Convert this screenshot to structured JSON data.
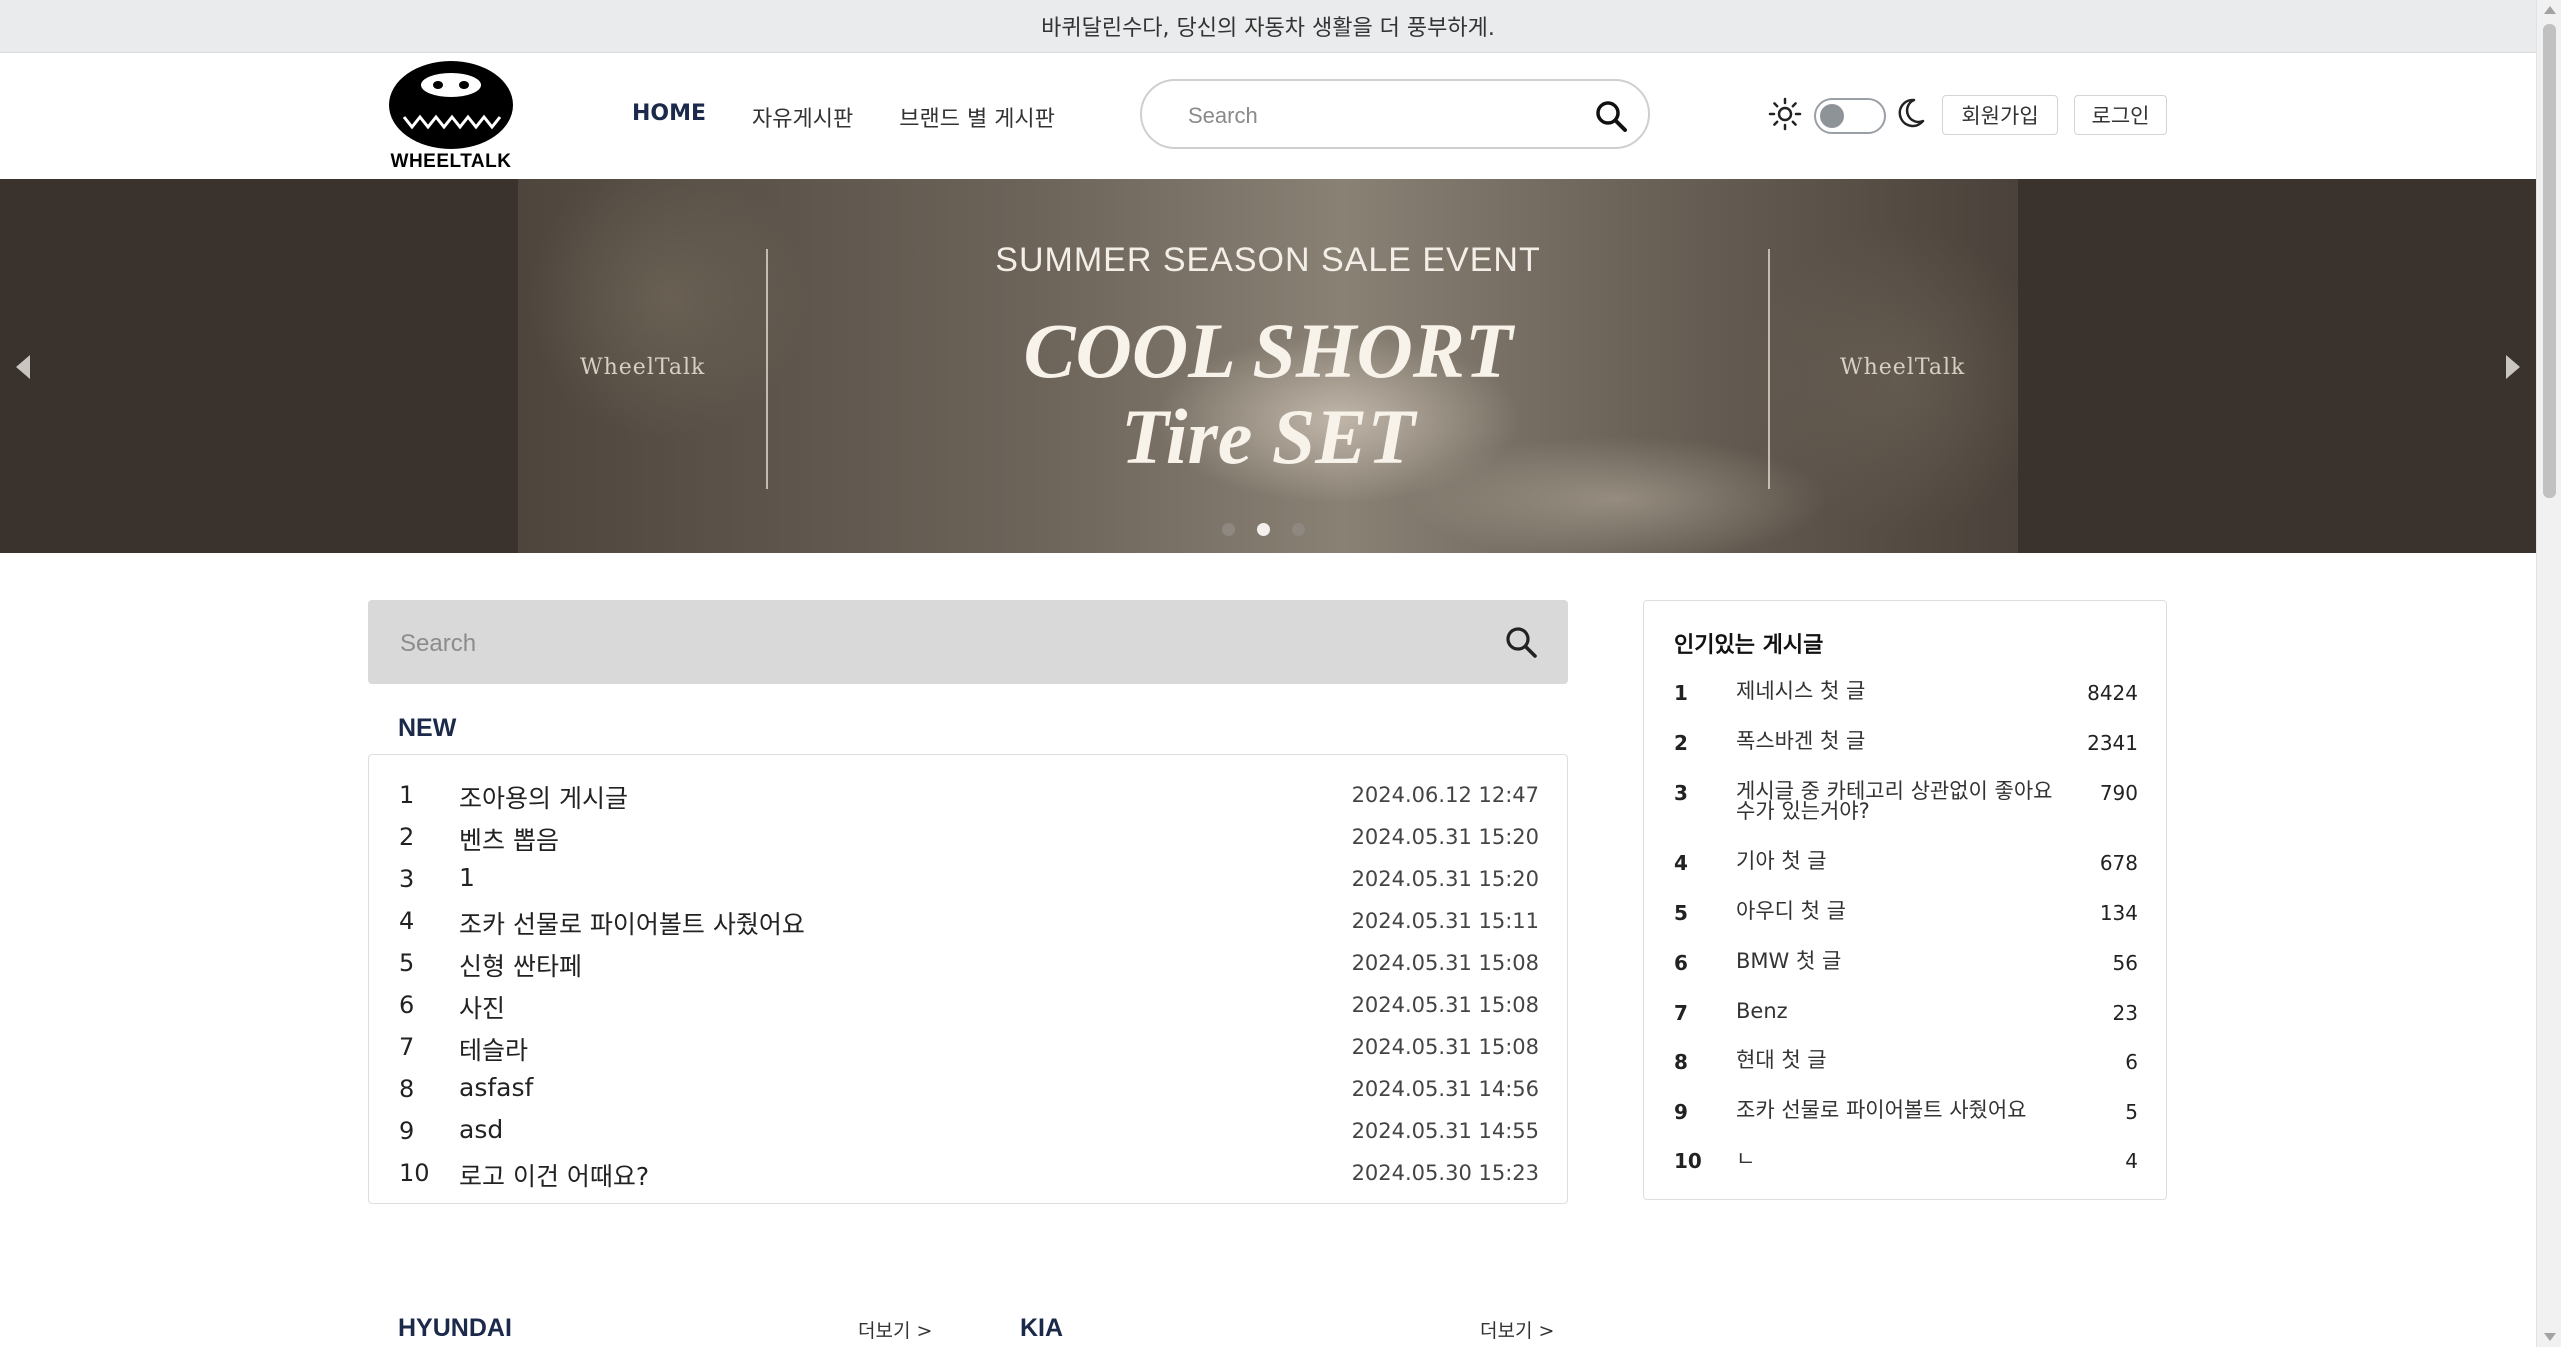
{
  "announcement": "바퀴달린수다, 당신의 자동차 생활을 더 풍부하게.",
  "logo": {
    "text": "WHEELTALK",
    "icon": "wheel-face-icon"
  },
  "nav": [
    {
      "label": "HOME",
      "active": true
    },
    {
      "label": "자유게시판",
      "active": false
    },
    {
      "label": "브랜드 별 게시판",
      "active": false
    }
  ],
  "header_search": {
    "placeholder": "Search",
    "icon": "search-icon"
  },
  "theme": {
    "sun_icon": "sun-icon",
    "moon_icon": "moon-icon",
    "dark_mode": false
  },
  "auth": {
    "signup": "회원가입",
    "login": "로그인"
  },
  "banner": {
    "subtitle": "SUMMER SEASON SALE EVENT",
    "title_line1": "COOL SHORT",
    "title_line2": "Tire SET",
    "watermark": "WheelTalk",
    "slide_count": 3,
    "active_slide": 2
  },
  "main_search": {
    "placeholder": "Search",
    "icon": "search-icon"
  },
  "new_section": {
    "title": "NEW",
    "items": [
      {
        "num": "1",
        "title": "조아용의 게시글",
        "date": "2024.06.12 12:47"
      },
      {
        "num": "2",
        "title": "벤츠 뽑음",
        "date": "2024.05.31 15:20"
      },
      {
        "num": "3",
        "title": "1",
        "date": "2024.05.31 15:20"
      },
      {
        "num": "4",
        "title": "조카 선물로 파이어볼트 사줬어요",
        "date": "2024.05.31 15:11"
      },
      {
        "num": "5",
        "title": "신형 싼타페",
        "date": "2024.05.31 15:08"
      },
      {
        "num": "6",
        "title": "사진",
        "date": "2024.05.31 15:08"
      },
      {
        "num": "7",
        "title": "테슬라",
        "date": "2024.05.31 15:08"
      },
      {
        "num": "8",
        "title": "asfasf",
        "date": "2024.05.31 14:56"
      },
      {
        "num": "9",
        "title": "asd",
        "date": "2024.05.31 14:55"
      },
      {
        "num": "10",
        "title": "로고 이건 어때요?",
        "date": "2024.05.30 15:23"
      }
    ]
  },
  "popular": {
    "title": "인기있는 게시글",
    "items": [
      {
        "num": "1",
        "title": "제네시스 첫 글",
        "count": "8424"
      },
      {
        "num": "2",
        "title": "폭스바겐 첫 글",
        "count": "2341"
      },
      {
        "num": "3",
        "title": "게시글 중 카테고리 상관없이 좋아요 수가 있는거야?",
        "count": "790"
      },
      {
        "num": "4",
        "title": "기아 첫 글",
        "count": "678"
      },
      {
        "num": "5",
        "title": "아우디 첫 글",
        "count": "134"
      },
      {
        "num": "6",
        "title": "BMW 첫 글",
        "count": "56"
      },
      {
        "num": "7",
        "title": "Benz",
        "count": "23"
      },
      {
        "num": "8",
        "title": "현대 첫 글",
        "count": "6"
      },
      {
        "num": "9",
        "title": "조카 선물로 파이어볼트 사줬어요",
        "count": "5"
      },
      {
        "num": "10",
        "title": "ㄴ",
        "count": "4"
      }
    ]
  },
  "brand_sections": [
    {
      "title": "HYUNDAI",
      "more": "더보기 >"
    },
    {
      "title": "KIA",
      "more": "더보기 >"
    }
  ]
}
